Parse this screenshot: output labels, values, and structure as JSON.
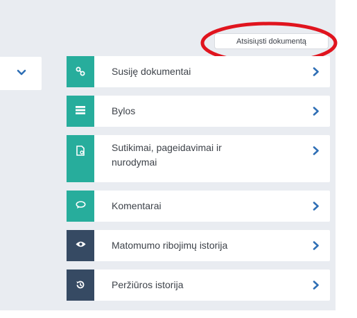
{
  "download_button": {
    "label": "Atsisiųsti dokumentą"
  },
  "colors": {
    "teal": "#27ad9c",
    "navy": "#364a63",
    "arrow": "#2f6fb5",
    "highlight": "#e0141e"
  },
  "sections": [
    {
      "label": "Susiję dokumentai",
      "icon": "link-icon",
      "color": "teal"
    },
    {
      "label": "Bylos",
      "icon": "list-icon",
      "color": "teal"
    },
    {
      "label": "Sutikimai, pageidavimai ir nurodymai",
      "icon": "document-icon",
      "color": "teal"
    },
    {
      "label": "Komentarai",
      "icon": "comments-icon",
      "color": "teal"
    },
    {
      "label": "Matomumo ribojimų istorija",
      "icon": "eye-icon",
      "color": "navy"
    },
    {
      "label": "Peržiūros istorija",
      "icon": "history-icon",
      "color": "navy"
    }
  ]
}
